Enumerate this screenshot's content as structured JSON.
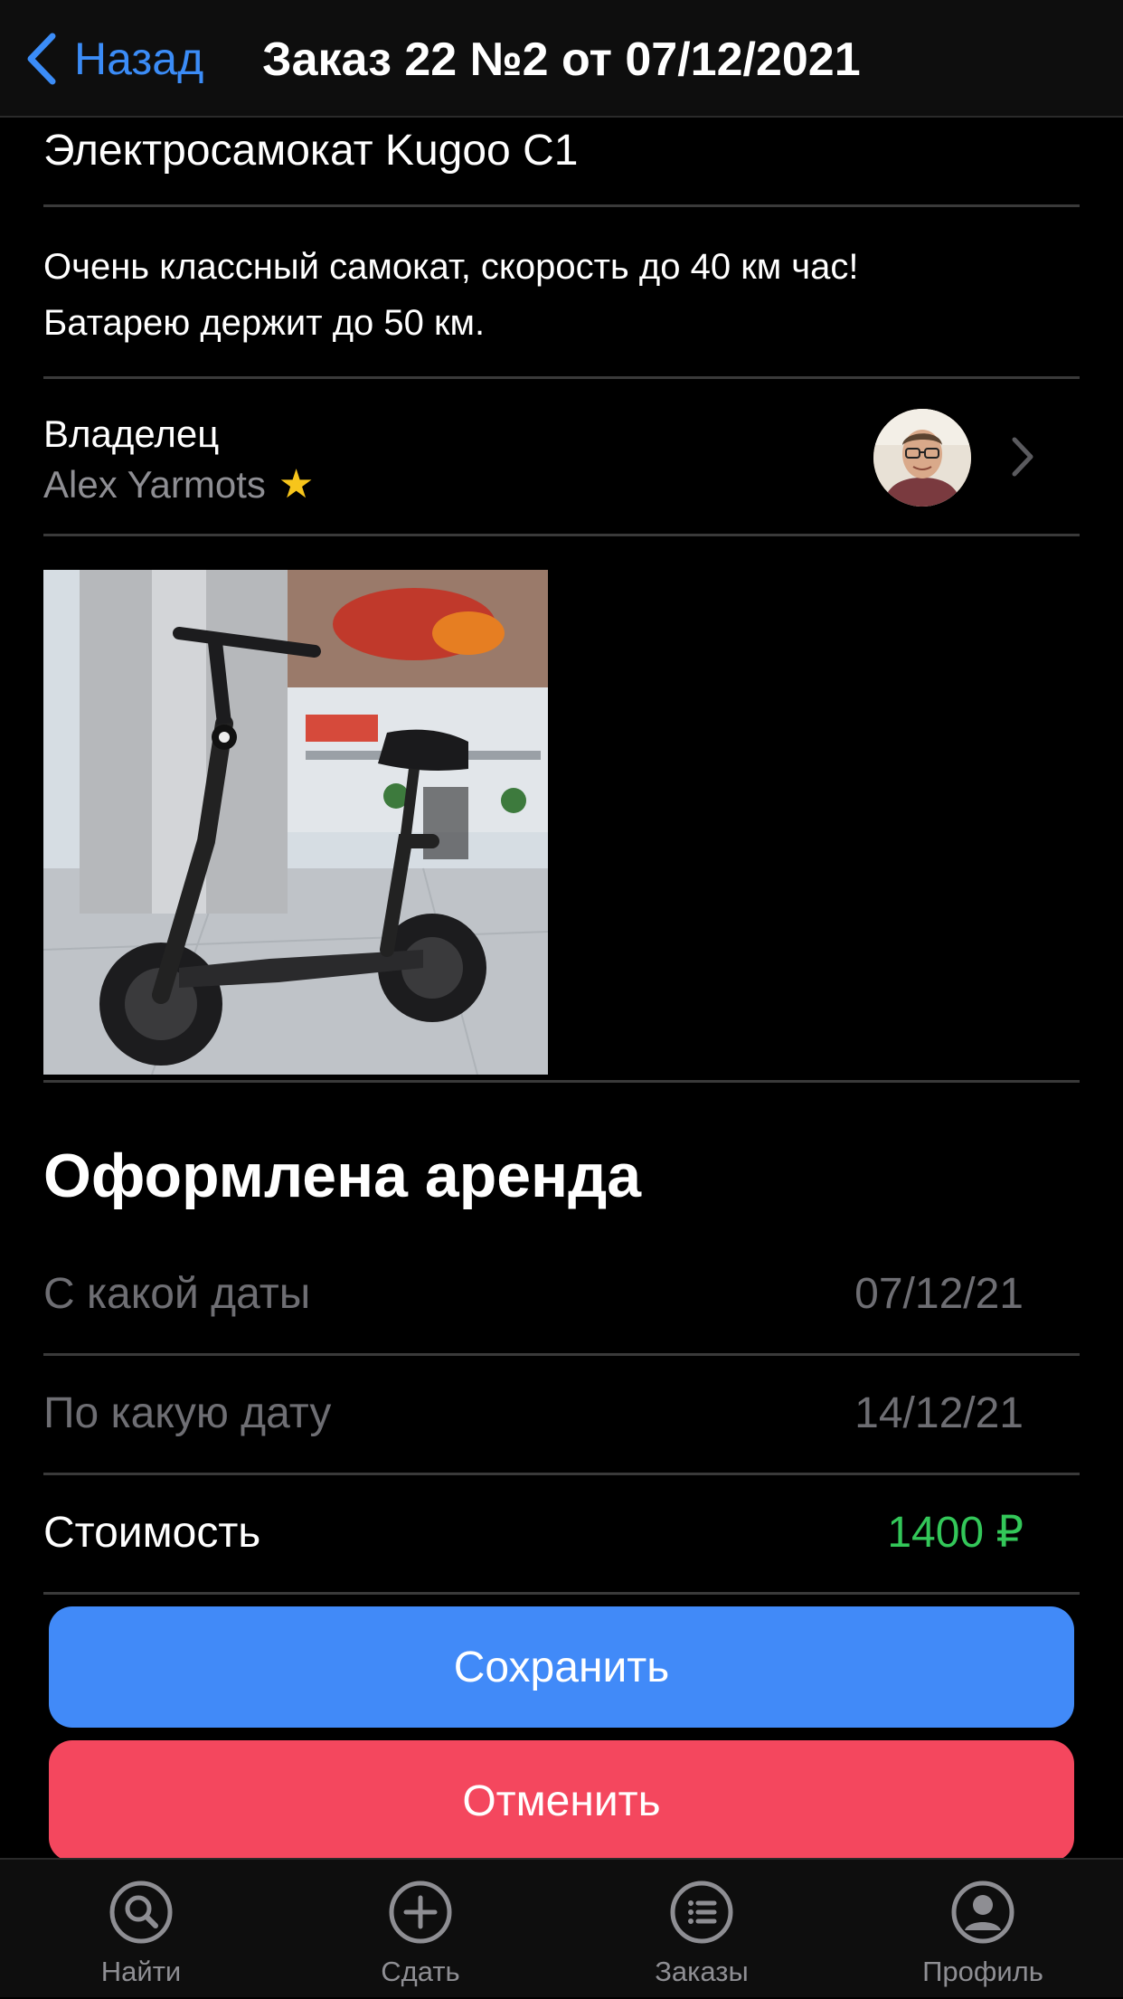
{
  "nav": {
    "back_label": "Назад",
    "title": "Заказ 22 №2 от 07/12/2021"
  },
  "item": {
    "title": "Электросамокат Kugoo C1",
    "description_line1": "Очень классный самокат, скорость до 40 км час!",
    "description_line2": "Батарею держит до 50 км."
  },
  "owner": {
    "label": "Владелец",
    "name": "Alex Yarmots",
    "badge_icon": "star-icon"
  },
  "rental": {
    "section_title": "Оформлена аренда",
    "from_label": "С какой даты",
    "from_value": "07/12/21",
    "to_label": "По какую дату",
    "to_value": "14/12/21",
    "cost_label": "Стоимость",
    "cost_value": "1400 ₽"
  },
  "actions": {
    "save_label": "Сохранить",
    "cancel_label": "Отменить"
  },
  "tabbar": {
    "tabs": [
      {
        "label": "Найти",
        "icon": "search-icon"
      },
      {
        "label": "Сдать",
        "icon": "plus-icon"
      },
      {
        "label": "Заказы",
        "icon": "list-icon"
      },
      {
        "label": "Профиль",
        "icon": "profile-icon"
      }
    ]
  },
  "colors": {
    "accent": "#418af8",
    "danger": "#f4475e",
    "price": "#33c759",
    "star": "#f7c51b"
  }
}
